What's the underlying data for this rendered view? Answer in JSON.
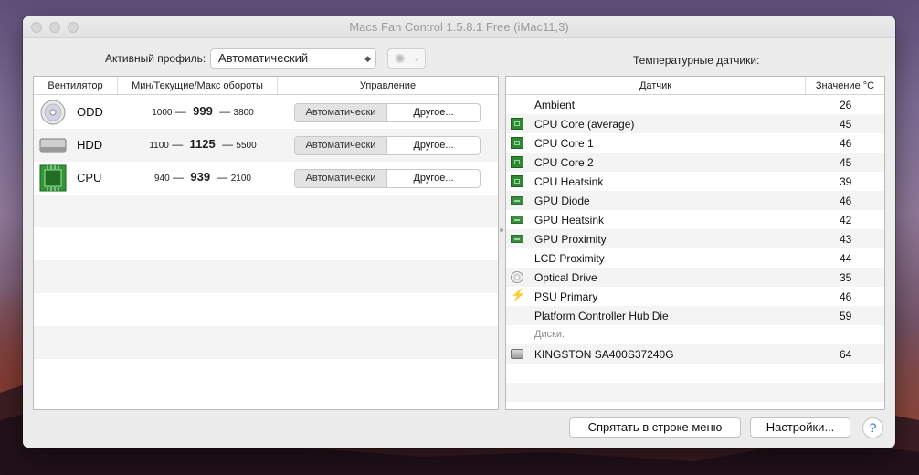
{
  "window": {
    "title": "Macs Fan Control 1.5.8.1 Free (iMac11,3)"
  },
  "profile": {
    "label": "Активный профиль:",
    "selected": "Автоматический"
  },
  "fans": {
    "headers": {
      "fan": "Вентилятор",
      "speeds": "Мин/Текущие/Макс обороты",
      "control": "Управление"
    },
    "rows": [
      {
        "name": "ODD",
        "icon": "optical-drive-icon",
        "min": "1000",
        "current": "999",
        "max": "3800",
        "auto_label": "Автоматически",
        "other_label": "Другое..."
      },
      {
        "name": "HDD",
        "icon": "hard-drive-icon",
        "min": "1100",
        "current": "1125",
        "max": "5500",
        "auto_label": "Автоматически",
        "other_label": "Другое..."
      },
      {
        "name": "CPU",
        "icon": "cpu-chip-icon",
        "min": "940",
        "current": "939",
        "max": "2100",
        "auto_label": "Автоматически",
        "other_label": "Другое..."
      }
    ]
  },
  "sensors": {
    "title": "Температурные датчики:",
    "headers": {
      "sensor": "Датчик",
      "value": "Значение °C"
    },
    "rows": [
      {
        "name": "Ambient",
        "value": "26",
        "icon": ""
      },
      {
        "name": "CPU Core (average)",
        "value": "45",
        "icon": "cpu-chip-icon"
      },
      {
        "name": "CPU Core 1",
        "value": "46",
        "icon": "cpu-chip-icon"
      },
      {
        "name": "CPU Core 2",
        "value": "45",
        "icon": "cpu-chip-icon"
      },
      {
        "name": "CPU Heatsink",
        "value": "39",
        "icon": "cpu-chip-icon"
      },
      {
        "name": "GPU Diode",
        "value": "46",
        "icon": "gpu-card-icon"
      },
      {
        "name": "GPU Heatsink",
        "value": "42",
        "icon": "gpu-card-icon"
      },
      {
        "name": "GPU Proximity",
        "value": "43",
        "icon": "gpu-card-icon"
      },
      {
        "name": "LCD Proximity",
        "value": "44",
        "icon": ""
      },
      {
        "name": "Optical Drive",
        "value": "35",
        "icon": "optical-drive-icon"
      },
      {
        "name": "PSU Primary",
        "value": "46",
        "icon": "lightning-bolt-icon"
      },
      {
        "name": "Platform Controller Hub Die",
        "value": "59",
        "icon": ""
      },
      {
        "name": "Диски:",
        "value": "",
        "icon": "",
        "group": true
      },
      {
        "name": "KINGSTON SA400S37240G",
        "value": "64",
        "icon": "hard-drive-icon"
      }
    ]
  },
  "buttons": {
    "hide_in_menubar": "Спрятать в строке меню",
    "settings": "Настройки...",
    "help": "?"
  }
}
